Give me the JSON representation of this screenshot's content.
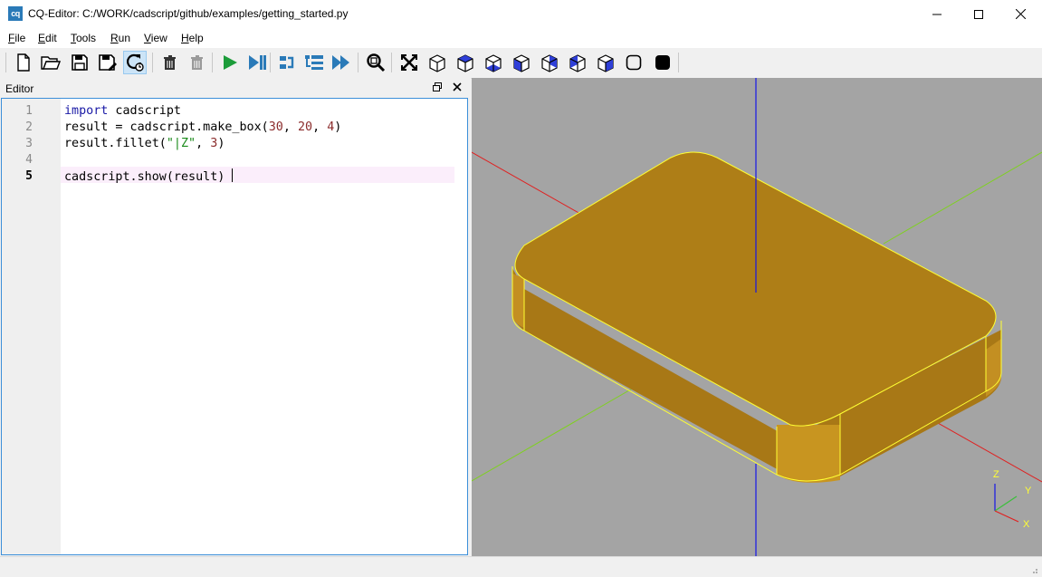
{
  "window": {
    "app_icon_text": "cq",
    "title": "CQ-Editor: C:/WORK/cadscript/github/examples/getting_started.py",
    "minimize_icon": "minimize-icon",
    "maximize_icon": "maximize-icon",
    "close_icon": "close-icon"
  },
  "menu": [
    {
      "mnemonic": "F",
      "rest": "ile"
    },
    {
      "mnemonic": "E",
      "rest": "dit"
    },
    {
      "mnemonic": "T",
      "rest": "ools"
    },
    {
      "mnemonic": "R",
      "rest": "un"
    },
    {
      "mnemonic": "V",
      "rest": "iew"
    },
    {
      "mnemonic": "H",
      "rest": "elp"
    }
  ],
  "toolbar": {
    "icons": [
      "new-file-icon",
      "open-file-icon",
      "save-icon",
      "save-as-icon",
      "autoreload-icon",
      "clear-icon",
      "delete-icon",
      "run-icon",
      "debug-icon",
      "step-icon",
      "step-over-icon",
      "continue-icon",
      "zoom-fit-icon",
      "fit-icon",
      "iso-view-icon",
      "top-view-icon",
      "bottom-view-icon",
      "front-view-icon",
      "back-view-icon",
      "left-view-icon",
      "right-view-icon",
      "wireframe-icon",
      "shaded-icon"
    ],
    "active": "autoreload-icon"
  },
  "editor": {
    "title": "Editor",
    "float_icon": "float-icon",
    "close_icon": "close-icon",
    "current_line": 5,
    "lines": [
      {
        "num": "1",
        "text": "import cadscript"
      },
      {
        "num": "2",
        "text": "result = cadscript.make_box(30, 20, 4)"
      },
      {
        "num": "3",
        "text": "result.fillet(\"|Z\", 3)"
      },
      {
        "num": "4",
        "text": ""
      },
      {
        "num": "5",
        "text": "cadscript.show(result)"
      }
    ],
    "code": {
      "l1_kw": "import",
      "l1_rest": " cadscript",
      "l2_a": "result = cadscript.make_box(",
      "l2_n1": "30",
      "l2_c1": ", ",
      "l2_n2": "20",
      "l2_c2": ", ",
      "l2_n3": "4",
      "l2_end": ")",
      "l3_a": "result.fillet(",
      "l3_s": "\"|Z\"",
      "l3_c": ", ",
      "l3_n": "3",
      "l3_end": ")",
      "l5": "cadscript.show(result) "
    }
  },
  "viewer": {
    "background": "#a4a4a4",
    "shape_color": "#ae7e17",
    "edge_color": "#ffff33",
    "axes": {
      "z": "Z",
      "y": "Y",
      "x": "X"
    }
  },
  "colors": {
    "accent": "#3c8fd9",
    "current_line": "#fbeefb",
    "run_green": "#1c9c3a",
    "step_blue": "#2a7ab8"
  }
}
